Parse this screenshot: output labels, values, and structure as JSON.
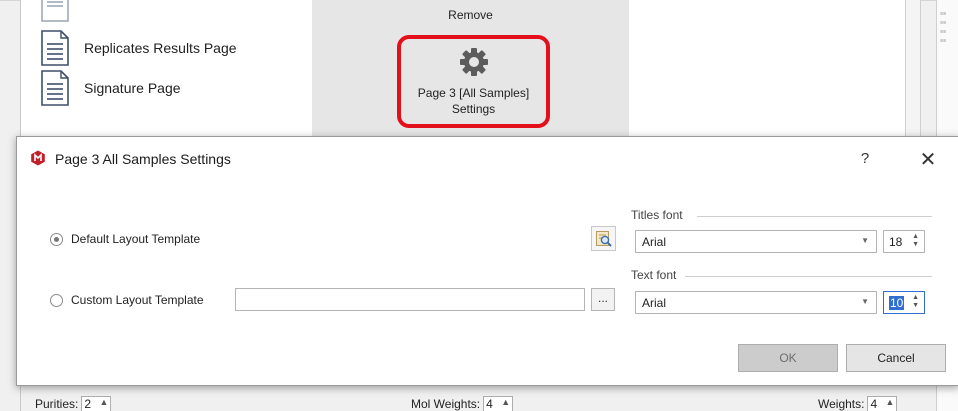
{
  "background": {
    "left_panel": {
      "items": [
        {
          "label": "Replicates Results Page",
          "icon": "document-icon"
        },
        {
          "label": "Signature Page",
          "icon": "document-icon"
        }
      ]
    },
    "ribbon": {
      "remove_label": "Remove",
      "settings_label": "Page 3 [All Samples] Settings",
      "settings_icon": "gear-icon",
      "highlight_color": "#e3101c"
    },
    "bottom_fields": {
      "purities_label": "Purities:",
      "purities_value": "2",
      "mol_weights_label": "Mol Weights:",
      "mol_weights_value": "4",
      "weights_label": "Weights:",
      "weights_value": "4"
    }
  },
  "dialog": {
    "title": "Page 3 All Samples Settings",
    "app_icon": "app-logo-icon",
    "help_label": "?",
    "close_label": "✕",
    "default_layout_label": "Default Layout Template",
    "default_layout_checked": true,
    "custom_layout_label": "Custom Layout Template",
    "custom_layout_checked": false,
    "custom_path_value": "",
    "browse_label": "...",
    "preview_icon": "preview-icon",
    "titles_font": {
      "label": "Titles font",
      "font": "Arial",
      "size": "18"
    },
    "text_font": {
      "label": "Text font",
      "font": "Arial",
      "size": "10"
    },
    "ok_label": "OK",
    "cancel_label": "Cancel"
  }
}
